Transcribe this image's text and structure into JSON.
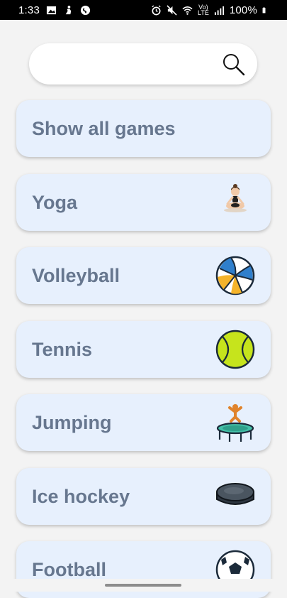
{
  "status_bar": {
    "time": "1:33",
    "network_top": "Vo)",
    "network_bottom": "LTE",
    "battery": "100%"
  },
  "search": {
    "value": "",
    "placeholder": "",
    "icon": "search-icon"
  },
  "games": [
    {
      "label": "Show all games",
      "icon": ""
    },
    {
      "label": "Yoga",
      "icon": "yoga-icon"
    },
    {
      "label": "Volleyball",
      "icon": "volleyball-icon"
    },
    {
      "label": "Tennis",
      "icon": "tennis-ball-icon"
    },
    {
      "label": "Jumping",
      "icon": "trampoline-icon"
    },
    {
      "label": "Ice hockey",
      "icon": "hockey-puck-icon"
    },
    {
      "label": "Football",
      "icon": "football-icon"
    }
  ],
  "colors": {
    "card_bg": "#e7f0fd",
    "label_text": "#67778f",
    "page_bg": "#f3f3f3"
  }
}
